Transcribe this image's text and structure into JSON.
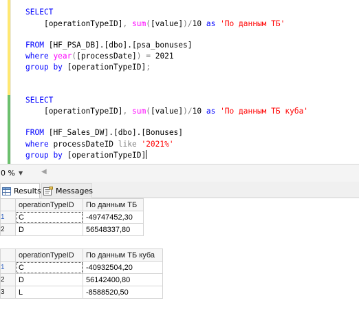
{
  "editor": {
    "query1": {
      "select": "SELECT",
      "col_indent": "    ",
      "col": "[operationTypeID]",
      "comma": ",",
      "sum_fn": "sum",
      "sum_open": "(",
      "sum_arg": "[value]",
      "sum_close": ")",
      "div": "/",
      "divisor": "10",
      "as_kw": "as",
      "alias": "'По данным ТБ'",
      "from_kw": "FROM",
      "table": "[HF_PSA_DB].[dbo].[psa_bonuses]",
      "where_kw": "where",
      "year_fn": "year",
      "year_open": "(",
      "year_arg": "[processDate]",
      "year_close": ")",
      "eq": "=",
      "year_value": "2021",
      "group_kw": "group",
      "by_kw": "by",
      "group_col": "[operationTypeID]",
      "semicolon": ";"
    },
    "query2": {
      "select": "SELECT",
      "col_indent": "    ",
      "col": "[operationTypeID]",
      "comma": ",",
      "sum_fn": "sum",
      "sum_open": "(",
      "sum_arg": "[value]",
      "sum_close": ")",
      "div": "/",
      "divisor": "10",
      "as_kw": "as",
      "alias": "'По данным ТБ куба'",
      "from_kw": "FROM",
      "table": "[HF_Sales_DW].[dbo].[Bonuses]",
      "where_kw": "where",
      "where_col": "processDateID",
      "like_kw": "like",
      "like_value": "'2021%'",
      "group_kw": "group",
      "by_kw": "by",
      "group_col": "[operationTypeID]"
    }
  },
  "zoom": {
    "value": "0 %"
  },
  "tabs": [
    {
      "label": "Results",
      "icon": "grid-icon"
    },
    {
      "label": "Messages",
      "icon": "messages-icon"
    }
  ],
  "results": [
    {
      "columns": [
        "operationTypeID",
        "По данным ТБ"
      ],
      "rows": [
        {
          "num": "1",
          "cells": [
            "C",
            "-49747452,30"
          ]
        },
        {
          "num": "2",
          "cells": [
            "D",
            "56548337,80"
          ]
        }
      ]
    },
    {
      "columns": [
        "operationTypeID",
        "По данным ТБ куба"
      ],
      "rows": [
        {
          "num": "1",
          "cells": [
            "C",
            "-40932504,20"
          ]
        },
        {
          "num": "2",
          "cells": [
            "D",
            "56142400,80"
          ]
        },
        {
          "num": "3",
          "cells": [
            "L",
            "-8588520,50"
          ]
        }
      ]
    }
  ],
  "colors": {
    "keyword": "#0000ff",
    "function": "#ff00ff",
    "string": "#ff0000",
    "operator": "#808080",
    "change_marker_saved": "#ffe872",
    "change_marker_unsaved": "#6cc06e"
  }
}
